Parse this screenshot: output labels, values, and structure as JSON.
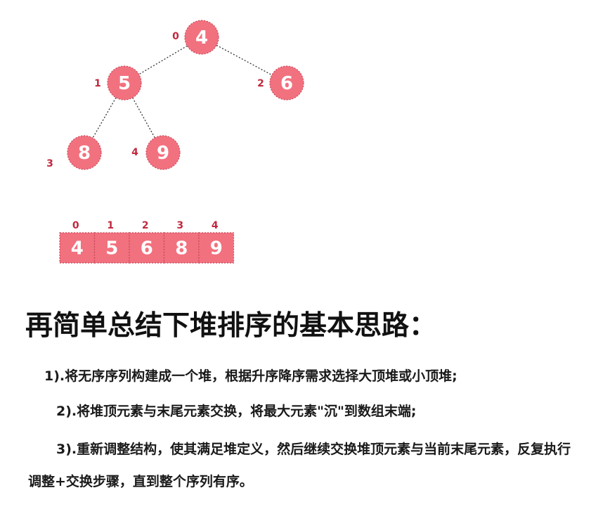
{
  "tree": {
    "nodes": [
      {
        "index": "0",
        "value": "4"
      },
      {
        "index": "1",
        "value": "5"
      },
      {
        "index": "2",
        "value": "6"
      },
      {
        "index": "3",
        "value": "8"
      },
      {
        "index": "4",
        "value": "9"
      }
    ],
    "edges": [
      [
        0,
        1
      ],
      [
        0,
        2
      ],
      [
        1,
        3
      ],
      [
        1,
        4
      ]
    ]
  },
  "array": {
    "indices": [
      "0",
      "1",
      "2",
      "3",
      "4"
    ],
    "values": [
      "4",
      "5",
      "6",
      "8",
      "9"
    ]
  },
  "colors": {
    "node_fill": "#f2717f",
    "node_stroke": "#c64a5a",
    "index_label": "#c0283e",
    "edge": "#333333"
  },
  "text": {
    "heading": "再简单总结下堆排序的基本思路：",
    "step1": "1).将无序序列构建成一个堆，根据升序降序需求选择大顶堆或小顶堆;",
    "step2": "2).将堆顶元素与末尾元素交换，将最大元素\"沉\"到数组末端;",
    "step3": "3).重新调整结构，使其满足堆定义，然后继续交换堆顶元素与当前末尾元素，反复执行调整+交换步骤，直到整个序列有序。"
  }
}
